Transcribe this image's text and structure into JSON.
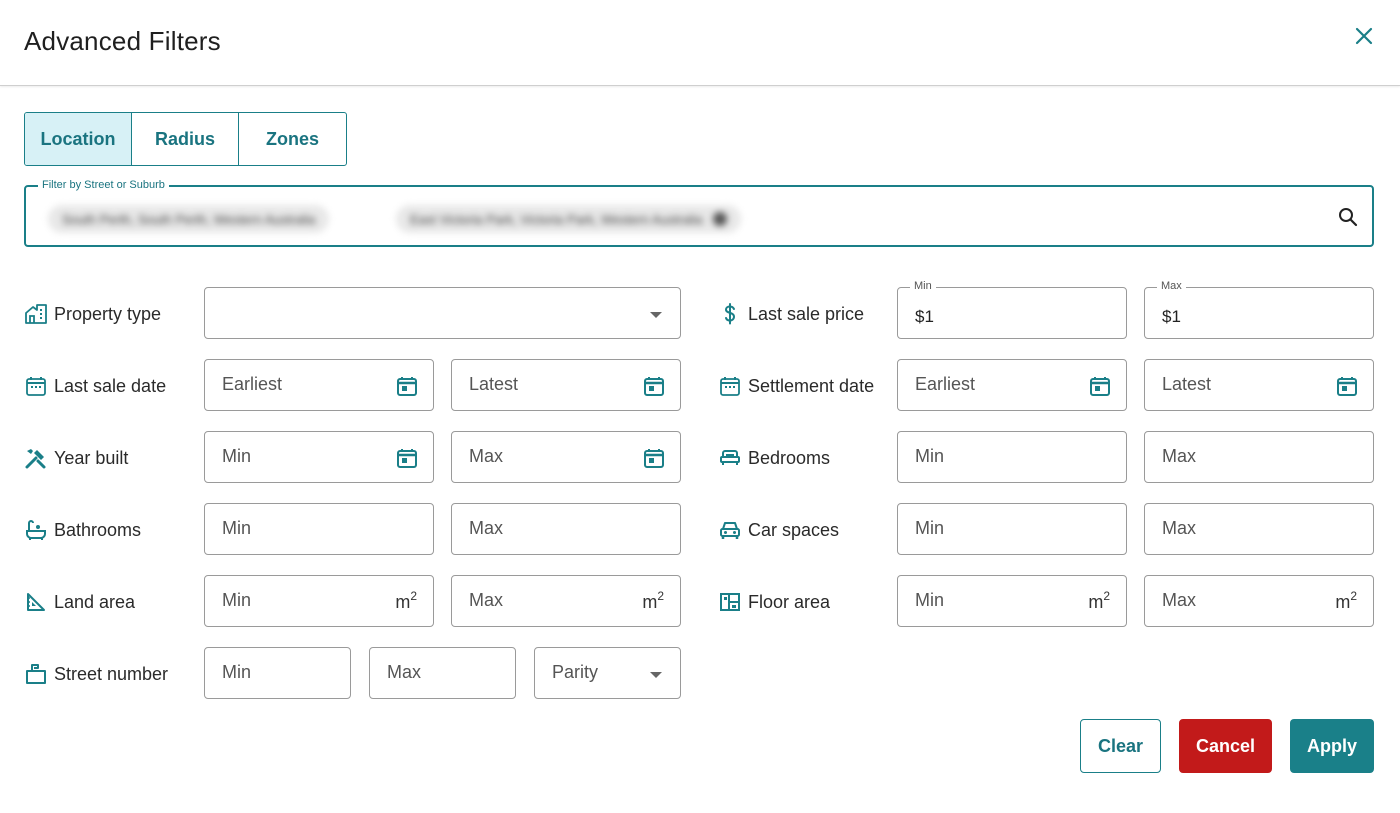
{
  "dialog": {
    "title": "Advanced Filters"
  },
  "tabs": [
    {
      "label": "Location",
      "active": true
    },
    {
      "label": "Radius",
      "active": false
    },
    {
      "label": "Zones",
      "active": false
    }
  ],
  "search": {
    "label": "Filter by Street or Suburb",
    "chips": [
      "South Perth, South Perth, Western Australia",
      "East Victoria Park, Victoria Park, Western Australia"
    ]
  },
  "filters": {
    "property_type": {
      "label": "Property type",
      "value": ""
    },
    "last_sale_price": {
      "label": "Last sale price",
      "min_label": "Min",
      "max_label": "Max",
      "min_value": "$1",
      "max_value": "$1"
    },
    "last_sale_date": {
      "label": "Last sale date",
      "earliest": "Earliest",
      "latest": "Latest"
    },
    "settlement_date": {
      "label": "Settlement date",
      "earliest": "Earliest",
      "latest": "Latest"
    },
    "year_built": {
      "label": "Year built",
      "min": "Min",
      "max": "Max"
    },
    "bedrooms": {
      "label": "Bedrooms",
      "min": "Min",
      "max": "Max"
    },
    "bathrooms": {
      "label": "Bathrooms",
      "min": "Min",
      "max": "Max"
    },
    "car_spaces": {
      "label": "Car spaces",
      "min": "Min",
      "max": "Max"
    },
    "land_area": {
      "label": "Land area",
      "min": "Min",
      "max": "Max",
      "unit": "m",
      "unit_sup": "2"
    },
    "floor_area": {
      "label": "Floor area",
      "min": "Min",
      "max": "Max",
      "unit": "m",
      "unit_sup": "2"
    },
    "street_number": {
      "label": "Street number",
      "min": "Min",
      "max": "Max",
      "parity": "Parity"
    }
  },
  "buttons": {
    "clear": "Clear",
    "cancel": "Cancel",
    "apply": "Apply"
  },
  "colors": {
    "accent": "#1a8089",
    "danger": "#c21a1a",
    "tab_active_bg": "#d7f1f6"
  },
  "icons": [
    "close-icon",
    "search-icon",
    "building-icon",
    "dollar-icon",
    "calendar-icon",
    "tools-icon",
    "bed-icon",
    "bathtub-icon",
    "car-icon",
    "ruler-triangle-icon",
    "floor-plan-icon",
    "mailbox-icon"
  ]
}
